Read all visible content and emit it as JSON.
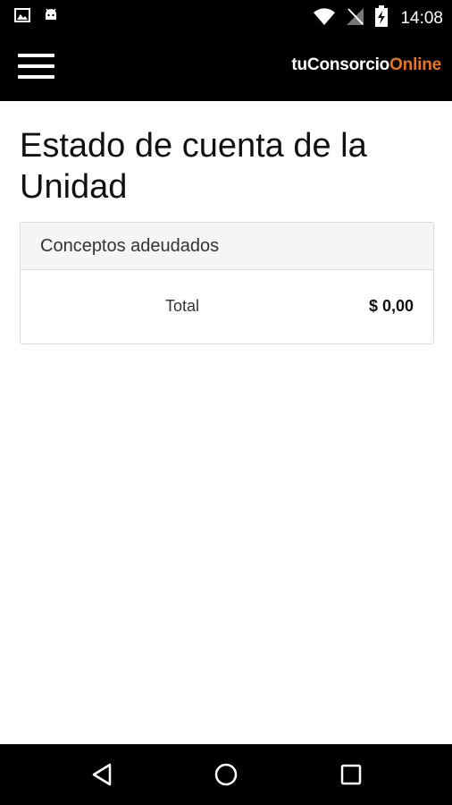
{
  "status_bar": {
    "time": "14:08",
    "left_icons": [
      "image-icon",
      "android-icon"
    ],
    "right_icons": [
      "wifi-icon",
      "no-signal-icon",
      "battery-charging-icon"
    ]
  },
  "header": {
    "brand_part1": "tuConsorcio",
    "brand_part2": "Online",
    "brand_accent_color": "#e8761e",
    "menu_icon": "hamburger-menu-icon"
  },
  "main": {
    "title": "Estado de cuenta de la Unidad",
    "panel": {
      "heading": "Conceptos adeudados",
      "total_label": "Total",
      "total_value": "$ 0,00"
    }
  },
  "nav_bar": {
    "icons": [
      "back-icon",
      "home-icon",
      "recents-icon"
    ]
  }
}
